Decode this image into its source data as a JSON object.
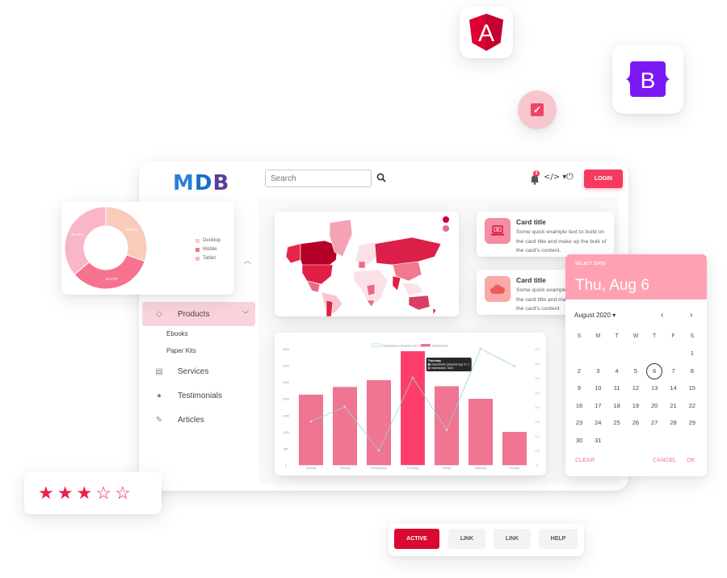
{
  "floating": {
    "angular_letter": "A",
    "bootstrap_letter": "B",
    "angular_color": "#dd0031",
    "bootstrap_color": "#7b19f4",
    "check_color": "#ee4466"
  },
  "topbar": {
    "logo_m": "M",
    "logo_d": "D",
    "logo_b": "B",
    "search_placeholder": "Search",
    "notification_count": "3",
    "code_label": "</> ▾",
    "login_label": "LOGIN",
    "accent": "#f43b5d"
  },
  "sidebar": {
    "items": [
      {
        "label": "Products",
        "icon": "gem-icon",
        "active": true
      },
      {
        "label": "Services",
        "icon": "calendar-icon"
      },
      {
        "label": "Testimonials",
        "icon": "user-icon"
      },
      {
        "label": "Articles",
        "icon": "pencil-icon"
      }
    ],
    "sub_items": [
      "Ebooks",
      "Paper Kits"
    ]
  },
  "cards": [
    {
      "title": "Card title",
      "text": "Some quick example text to build on the card title and make up the bulk of the card's content.",
      "icon": "laptop-code-icon"
    },
    {
      "title": "Card title",
      "text": "Some quick example text to build on the card title and make up the bulk of the card's content.",
      "icon": "cloud-icon"
    }
  ],
  "donut": {
    "legend": [
      "Desktop",
      "Mobile",
      "Tablet"
    ],
    "labels": [
      "30.30%",
      "33.47%",
      "36.23%"
    ]
  },
  "datepicker": {
    "label": "SELECT DATE",
    "selected_display": "Thu, Aug 6",
    "month_label": "August 2020 ▾",
    "weekdays": [
      "S",
      "M",
      "T",
      "W",
      "T",
      "F",
      "S"
    ],
    "first_weekday": 6,
    "days_in_month": 31,
    "selected_day": 6,
    "clear_label": "CLEAR",
    "cancel_label": "CANCEL",
    "ok_label": "OK"
  },
  "rating": {
    "value": 3,
    "max": 5
  },
  "button_group": {
    "active": "ACTIVE",
    "link1": "LINK",
    "link2": "LINK",
    "help": "HELP"
  },
  "chart_data": [
    {
      "type": "bar",
      "title": "",
      "categories": [
        "Monday",
        "Tuesday",
        "Wednesday",
        "Thursday",
        "Friday",
        "Saturday",
        "Sunday"
      ],
      "series": [
        {
          "name": "Impressions",
          "type": "bar",
          "axis": "left",
          "values": [
            2112,
            2343,
            2545,
            3423,
            2365,
            1985,
            987
          ]
        },
        {
          "name": "Impressions (absolute top) %",
          "type": "line",
          "axis": "right",
          "values": [
            1.5,
            2.0,
            0.5,
            3.0,
            1.2,
            4.0,
            3.4
          ]
        }
      ],
      "highlight_index": 3,
      "tooltip": {
        "title": "Thursday",
        "lines": [
          "Impressions (absolute top) %: 3",
          "Impressions: 3423"
        ]
      },
      "y_left_ticks": [
        "0",
        "500",
        "1000",
        "1500",
        "2000",
        "2500",
        "3000",
        "3500"
      ],
      "y_right_ticks": [
        "0",
        "0.5",
        "1.0",
        "1.5",
        "2.0",
        "2.5",
        "3.0",
        "3.5",
        "4.0"
      ],
      "ylim_left": [
        0,
        3500
      ],
      "ylim_right": [
        0,
        4
      ],
      "legend_position": "top",
      "colors": {
        "bar": "#f07592",
        "bar_highlight": "#ff3d6a",
        "line": "#8fd8cc"
      }
    },
    {
      "type": "pie",
      "title": "",
      "categories": [
        "Desktop",
        "Mobile",
        "Tablet"
      ],
      "values": [
        30.3,
        33.47,
        36.23
      ],
      "colors": [
        "#f9cbbb",
        "#f7728e",
        "#f9b6c6"
      ],
      "legend_position": "right"
    }
  ]
}
